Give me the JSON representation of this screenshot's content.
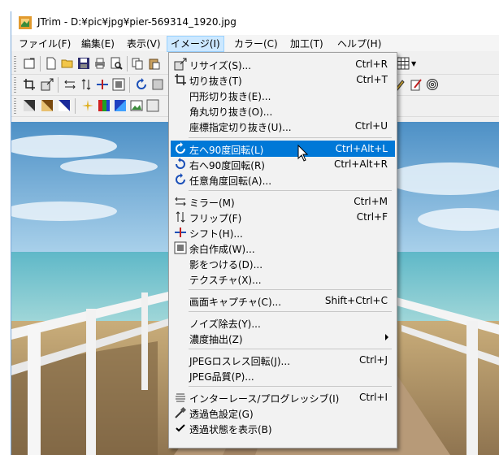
{
  "window": {
    "title": "JTrim - D:¥pic¥jpg¥pier-569314_1920.jpg"
  },
  "menubar": [
    {
      "label": "ファイル(F)"
    },
    {
      "label": "編集(E)"
    },
    {
      "label": "表示(V)"
    },
    {
      "label": "イメージ(I)"
    },
    {
      "label": "カラー(C)"
    },
    {
      "label": "加工(T)"
    },
    {
      "label": "ヘルプ(H)"
    }
  ],
  "image_menu": {
    "items": [
      {
        "label": "リサイズ(S)...",
        "shortcut": "Ctrl+R",
        "icon": "resize-icon"
      },
      {
        "label": "切り抜き(T)",
        "shortcut": "Ctrl+T",
        "icon": "crop-icon"
      },
      {
        "label": "円形切り抜き(E)...",
        "shortcut": "",
        "icon": ""
      },
      {
        "label": "角丸切り抜き(O)...",
        "shortcut": "",
        "icon": ""
      },
      {
        "label": "座標指定切り抜き(U)...",
        "shortcut": "Ctrl+U",
        "icon": ""
      },
      {
        "label": "左へ90度回転(L)",
        "shortcut": "Ctrl+Alt+L",
        "icon": "rotate-left-icon"
      },
      {
        "label": "右へ90度回転(R)",
        "shortcut": "Ctrl+Alt+R",
        "icon": "rotate-right-icon"
      },
      {
        "label": "任意角度回転(A)...",
        "shortcut": "",
        "icon": "rotate-any-icon"
      },
      {
        "label": "ミラー(M)",
        "shortcut": "Ctrl+M",
        "icon": "mirror-icon"
      },
      {
        "label": "フリップ(F)",
        "shortcut": "Ctrl+F",
        "icon": "flip-icon"
      },
      {
        "label": "シフト(H)...",
        "shortcut": "",
        "icon": "shift-icon"
      },
      {
        "label": "余白作成(W)...",
        "shortcut": "",
        "icon": "margin-icon"
      },
      {
        "label": "影をつける(D)...",
        "shortcut": "",
        "icon": ""
      },
      {
        "label": "テクスチャ(X)...",
        "shortcut": "",
        "icon": ""
      },
      {
        "label": "画面キャプチャ(C)...",
        "shortcut": "Shift+Ctrl+C",
        "icon": ""
      },
      {
        "label": "ノイズ除去(Y)...",
        "shortcut": "",
        "icon": ""
      },
      {
        "label": "濃度抽出(Z)",
        "shortcut": "",
        "icon": ""
      },
      {
        "label": "JPEGロスレス回転(J)...",
        "shortcut": "Ctrl+J",
        "icon": ""
      },
      {
        "label": "JPEG品質(P)...",
        "shortcut": "",
        "icon": ""
      },
      {
        "label": "インターレース/プログレッシブ(I)",
        "shortcut": "Ctrl+I",
        "icon": "interlace-icon"
      },
      {
        "label": "透過色設定(G)",
        "shortcut": "",
        "icon": "eyedropper-icon"
      },
      {
        "label": "透過状態を表示(B)",
        "shortcut": "",
        "icon": "checkmark-icon"
      }
    ]
  },
  "colors": {
    "highlight": "#0078d7",
    "menu_bg": "#f2f2f2",
    "active_menu": "#cce8ff"
  }
}
